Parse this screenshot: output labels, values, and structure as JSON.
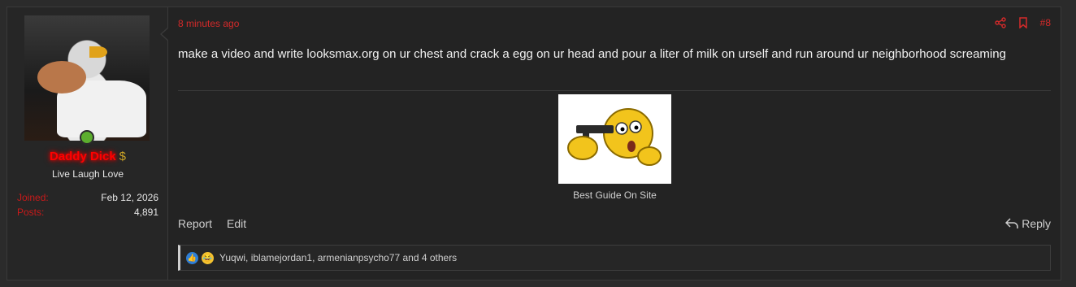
{
  "user": {
    "name": "Daddy Dick",
    "name_badge": "$",
    "title": "Live Laugh Love",
    "stats": [
      {
        "label": "Joined:",
        "value": "Feb 12, 2026"
      },
      {
        "label": "Posts:",
        "value": "4,891"
      }
    ],
    "online": true,
    "avatar_icon": "eagle-avatar"
  },
  "post": {
    "time": "8 minutes ago",
    "number": "#8",
    "message": "make a video and write looksmax.org on ur chest and crack a egg on ur head and pour a liter of milk on urself and run around ur neighborhood screaming",
    "image_caption": "Best Guide On Site",
    "image_icon": "smiley-gun-emoji"
  },
  "actions": {
    "report": "Report",
    "edit": "Edit",
    "reply": "Reply"
  },
  "reactions": {
    "text": "Yuqwi, iblamejordan1, armenianpsycho77 and 4 others",
    "icons": [
      "like-icon",
      "laugh-icon"
    ]
  },
  "colors": {
    "accent": "#d42a2a",
    "username": "#ff0000",
    "online": "#5cae2e",
    "background": "#232323"
  }
}
